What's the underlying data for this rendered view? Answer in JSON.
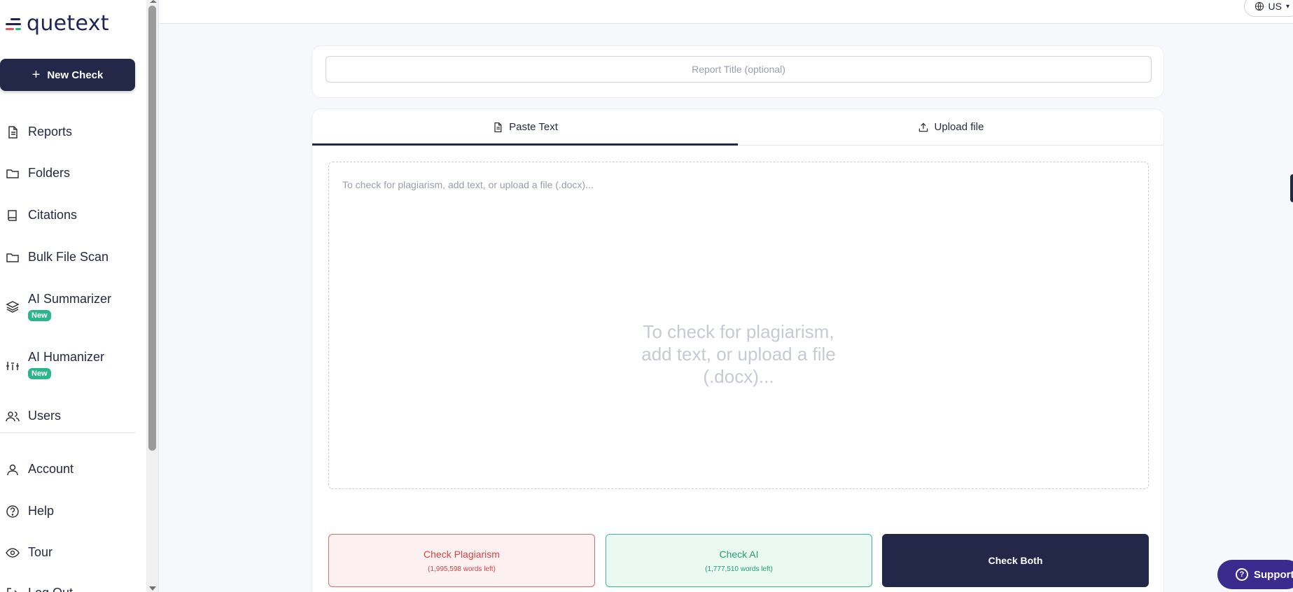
{
  "brand": {
    "logo_text": "quetext"
  },
  "sidebar": {
    "new_check_label": "New Check",
    "items": [
      {
        "label": "Reports",
        "icon": "document-icon"
      },
      {
        "label": "Folders",
        "icon": "folder-icon"
      },
      {
        "label": "Citations",
        "icon": "book-icon"
      },
      {
        "label": "Bulk File Scan",
        "icon": "folder-icon"
      },
      {
        "label": "AI Summarizer",
        "icon": "layers-icon",
        "badge": "New"
      },
      {
        "label": "AI Humanizer",
        "icon": "sliders-icon",
        "badge": "New"
      },
      {
        "label": "Users",
        "icon": "users-icon"
      },
      {
        "label": "Account",
        "icon": "user-icon"
      },
      {
        "label": "Help",
        "icon": "help-icon"
      },
      {
        "label": "Tour",
        "icon": "eye-icon"
      },
      {
        "label": "Log Out",
        "icon": "logout-icon"
      }
    ]
  },
  "topbar": {
    "language": "US"
  },
  "report": {
    "title_placeholder": "Report Title (optional)"
  },
  "tabs": [
    {
      "label": "Paste Text",
      "icon": "document-icon",
      "active": true
    },
    {
      "label": "Upload file",
      "icon": "upload-icon",
      "active": false
    }
  ],
  "editor": {
    "placeholder": "To check for plagiarism, add text, or upload a file (.docx)...",
    "center_hint": "To check for plagiarism, add text, or upload a file (.docx)..."
  },
  "actions": {
    "plagiarism": {
      "label": "Check Plagiarism",
      "sub": "(1,995,598 words left)"
    },
    "ai": {
      "label": "Check AI",
      "sub": "(1,777,510 words left)"
    },
    "both": {
      "label": "Check Both"
    }
  },
  "support": {
    "label": "Support"
  },
  "colors": {
    "primary": "#232848",
    "plagiarism": "#d64545",
    "ai": "#23a06f",
    "badge": "#2bb58a",
    "support": "#3b2b8f"
  }
}
